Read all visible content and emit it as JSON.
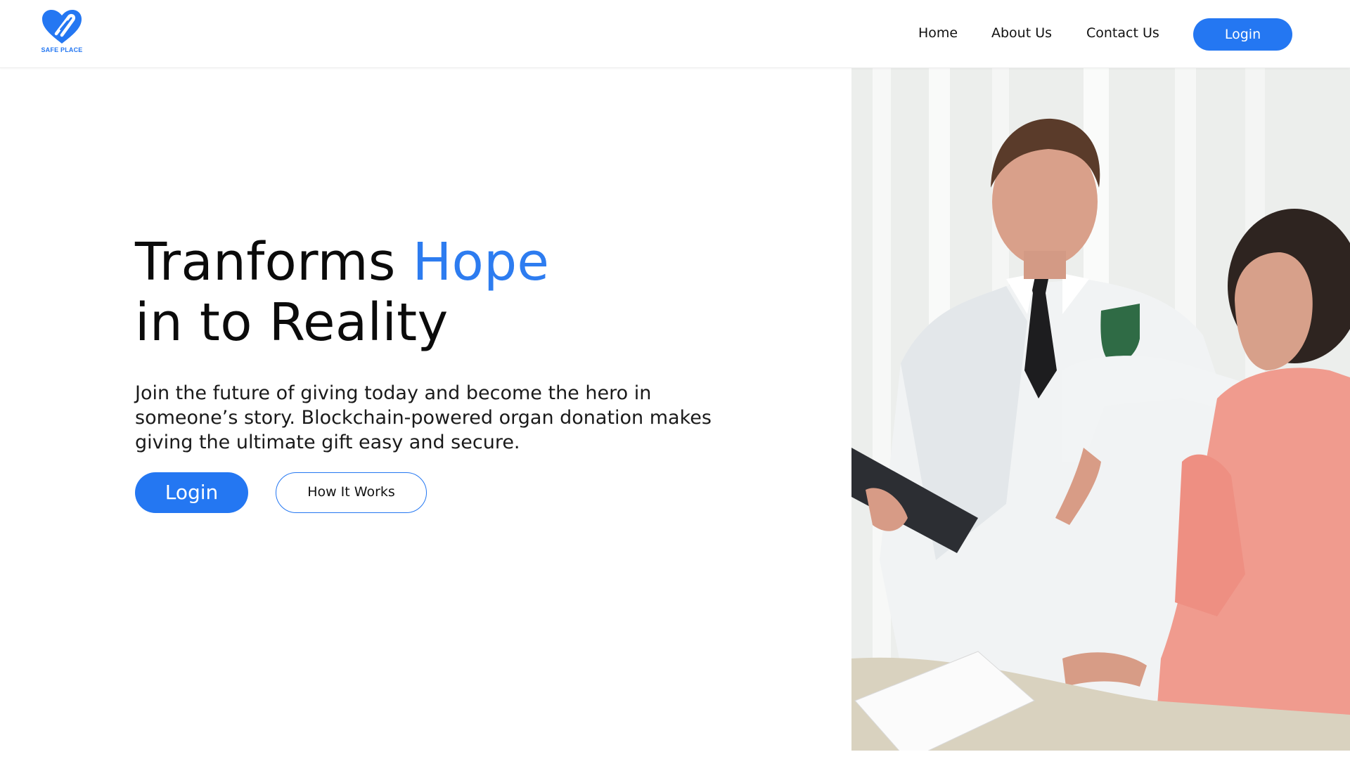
{
  "brand": {
    "name": "SAFE PLACE",
    "logo_icon": "heart-icon",
    "accent_color": "#2477f2"
  },
  "nav": {
    "items": [
      {
        "label": "Home"
      },
      {
        "label": "About Us"
      },
      {
        "label": "Contact Us"
      }
    ],
    "login_label": "Login"
  },
  "hero": {
    "title_part1": "Tranforms ",
    "title_accent": "Hope",
    "title_line2": "in to Reality",
    "subtitle": "Join the future of giving today and become the hero in someone’s story. Blockchain-powered organ donation makes giving the ultimate gift easy and secure.",
    "primary_button": "Login",
    "secondary_button": "How It Works",
    "image_subject": "doctor-with-patient-photo"
  }
}
